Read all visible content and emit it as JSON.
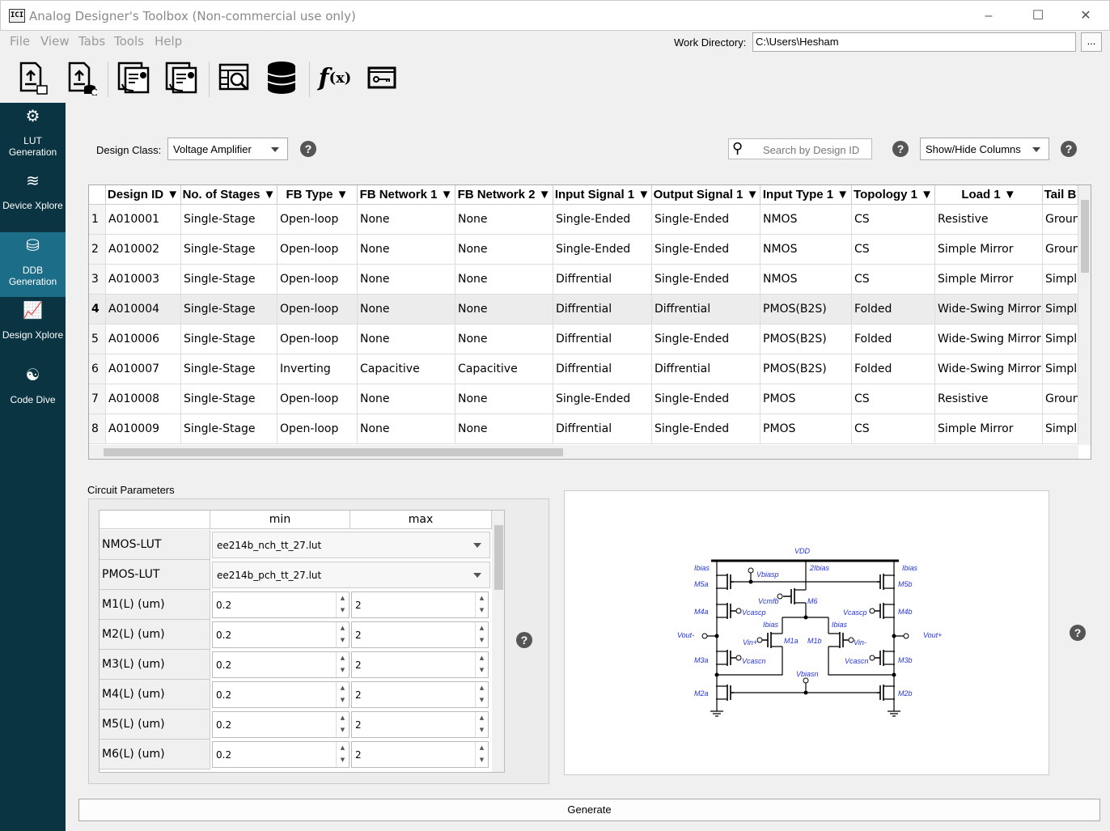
{
  "window": {
    "title": "Analog Designer's Toolbox (Non-commercial use only)",
    "app_icon_text": "ICI"
  },
  "menu": [
    "File",
    "View",
    "Tabs",
    "Tools",
    "Help"
  ],
  "work_directory": {
    "label": "Work Directory:",
    "value": "C:\\Users\\Hesham",
    "browse_label": "..."
  },
  "toolbar": [
    "upload-lut-icon",
    "upload-database-icon",
    "import-report-icon",
    "export-report-icon",
    "table-search-icon",
    "database-icon",
    "function-icon",
    "license-key-icon"
  ],
  "sidebar": [
    {
      "label": "LUT Generation",
      "icon": "gears-icon"
    },
    {
      "label": "Device Xplore",
      "icon": "chart-line-icon"
    },
    {
      "label": "DDB Generation",
      "icon": "database-add-icon",
      "active": true
    },
    {
      "label": "Design Xplore",
      "icon": "chart-area-icon"
    },
    {
      "label": "Code Dive",
      "icon": "headset-icon"
    }
  ],
  "design_class": {
    "label": "Design Class:",
    "value": "Voltage Amplifier"
  },
  "search": {
    "placeholder": "Search by Design ID"
  },
  "show_hide": {
    "label": "Show/Hide Columns"
  },
  "table": {
    "columns": [
      "Design ID",
      "No. of Stages",
      "FB Type",
      "FB Network 1",
      "FB Network 2",
      "Input Signal 1",
      "Output Signal 1",
      "Input Type 1",
      "Topology 1",
      "Load 1",
      "Tail B"
    ],
    "selected_row": 4,
    "rows": [
      [
        "A010001",
        "Single-Stage",
        "Open-loop",
        "None",
        "None",
        "Single-Ended",
        "Single-Ended",
        "NMOS",
        "CS",
        "Resistive",
        "Ground"
      ],
      [
        "A010002",
        "Single-Stage",
        "Open-loop",
        "None",
        "None",
        "Single-Ended",
        "Single-Ended",
        "NMOS",
        "CS",
        "Simple Mirror",
        "Ground"
      ],
      [
        "A010003",
        "Single-Stage",
        "Open-loop",
        "None",
        "None",
        "Diffrential",
        "Single-Ended",
        "NMOS",
        "CS",
        "Simple Mirror",
        "Simple"
      ],
      [
        "A010004",
        "Single-Stage",
        "Open-loop",
        "None",
        "None",
        "Diffrential",
        "Diffrential",
        "PMOS(B2S)",
        "Folded",
        "Wide-Swing Mirror",
        "Simple"
      ],
      [
        "A010006",
        "Single-Stage",
        "Open-loop",
        "None",
        "None",
        "Diffrential",
        "Single-Ended",
        "PMOS(B2S)",
        "Folded",
        "Wide-Swing Mirror",
        "Simple"
      ],
      [
        "A010007",
        "Single-Stage",
        "Inverting",
        "Capacitive",
        "Capacitive",
        "Diffrential",
        "Diffrential",
        "PMOS(B2S)",
        "Folded",
        "Wide-Swing Mirror",
        "Simple"
      ],
      [
        "A010008",
        "Single-Stage",
        "Open-loop",
        "None",
        "None",
        "Single-Ended",
        "Single-Ended",
        "PMOS",
        "CS",
        "Resistive",
        "Ground"
      ],
      [
        "A010009",
        "Single-Stage",
        "Open-loop",
        "None",
        "None",
        "Diffrential",
        "Single-Ended",
        "PMOS",
        "CS",
        "Simple Mirror",
        "Simple"
      ]
    ]
  },
  "circuit_parameters": {
    "title": "Circuit Parameters",
    "headers": [
      "min",
      "max"
    ],
    "luts": [
      {
        "label": "NMOS-LUT",
        "value": "ee214b_nch_tt_27.lut"
      },
      {
        "label": "PMOS-LUT",
        "value": "ee214b_pch_tt_27.lut"
      }
    ],
    "params": [
      {
        "label": "M1(L) (um)",
        "min": "0.2",
        "max": "2"
      },
      {
        "label": "M2(L) (um)",
        "min": "0.2",
        "max": "2"
      },
      {
        "label": "M3(L) (um)",
        "min": "0.2",
        "max": "2"
      },
      {
        "label": "M4(L) (um)",
        "min": "0.2",
        "max": "2"
      },
      {
        "label": "M5(L) (um)",
        "min": "0.2",
        "max": "2"
      },
      {
        "label": "M6(L) (um)",
        "min": "0.2",
        "max": "2"
      }
    ]
  },
  "schematic": {
    "labels": [
      "VDD",
      "Ibias",
      "Vbiasp",
      "2Ibias",
      "Ibias",
      "M5a",
      "M5b",
      "Vcmfb",
      "M6",
      "M4a",
      "Vcascp",
      "Vcascp",
      "M4b",
      "Ibias",
      "Ibias",
      "Vout-",
      "Vout+",
      "Vin+",
      "M1a",
      "M1b",
      "Vin-",
      "M3a",
      "Vcascn",
      "Vcascn",
      "M3b",
      "Vbiasn",
      "M2a",
      "M2b"
    ],
    "color": "#2233dd"
  },
  "generate_label": "Generate"
}
